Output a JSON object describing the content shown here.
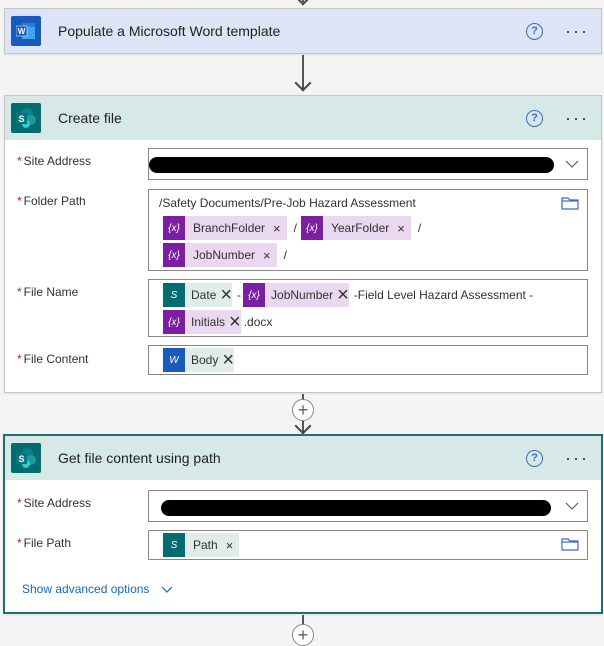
{
  "populate_card": {
    "title": "Populate a Microsoft Word template",
    "help": "?",
    "more": "···"
  },
  "create_file_card": {
    "title": "Create file",
    "help": "?",
    "more": "···",
    "fields": {
      "site_address": {
        "label": "Site Address",
        "required": "*"
      },
      "folder_path": {
        "label": "Folder Path",
        "required": "*",
        "text_prefix": "/Safety Documents/Pre-Job Hazard Assessment",
        "token_1": "BranchFolder",
        "sep_1": "/",
        "token_2": "YearFolder",
        "sep_2": "/",
        "token_3": "JobNumber",
        "sep_3": "/"
      },
      "file_name": {
        "label": "File Name",
        "required": "*",
        "token_date": "Date",
        "dash_1": "-",
        "token_jobnumber": "JobNumber",
        "text_middle": "-Field Level Hazard Assessment -",
        "token_initials": "Initials",
        "text_ext": ".docx"
      },
      "file_content": {
        "label": "File Content",
        "required": "*",
        "token_body": "Body"
      }
    }
  },
  "get_file_card": {
    "title": "Get file content using path",
    "help": "?",
    "more": "···",
    "fields": {
      "site_address": {
        "label": "Site Address",
        "required": "*"
      },
      "file_path": {
        "label": "File Path",
        "required": "*",
        "token_path": "Path"
      }
    },
    "advanced_link": "Show advanced options"
  },
  "icons": {
    "var_token": "{x}",
    "remove": "×",
    "plus": "+"
  },
  "colors": {
    "word_blue": "#185abd",
    "sharepoint_teal": "#036c70",
    "variable_purple": "#7b1fa2",
    "link_blue": "#0f6cbd"
  }
}
